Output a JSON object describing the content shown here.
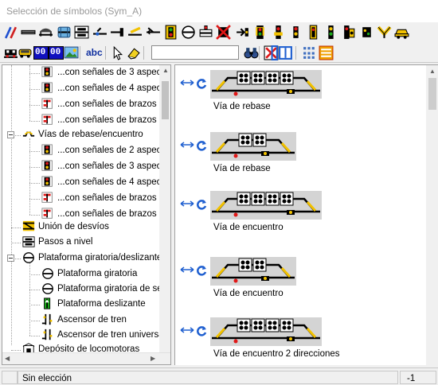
{
  "window": {
    "title": "Selección de símbolos (Sym_A)"
  },
  "toolbar1": {
    "icons": [
      "pencils-icon",
      "straight-track-icon",
      "tunnel-icon",
      "bridge-icon",
      "level-crossing-icon",
      "turnout-left-icon",
      "track-end-icon",
      "signal-yellow-icon",
      "turnout-right-icon",
      "signal-block-icon",
      "turntable-icon",
      "cross-signal-icon",
      "no-signal-icon",
      "arrow-signal-icon",
      "main-signal-icon",
      "shunt-signal-icon",
      "dwarf-signal-icon",
      "light-signal-icon",
      "distant-signal-icon",
      "combined-signal-icon",
      "repeater-signal-icon",
      "bumper-icon",
      "car-icon"
    ]
  },
  "toolbar2": {
    "icons": [
      "locomotive-icon",
      "car-yellow-icon",
      "digit-display-icon",
      "digit-display2-icon",
      "picture-icon",
      "text-abc-icon",
      "pointer-icon",
      "eraser-icon",
      "binoculars-icon",
      "no-symbol-icon",
      "frame-icon",
      "grid-view-icon",
      "list-view-icon"
    ],
    "abc_label": "abc",
    "display1": "00",
    "display2": "00",
    "search_value": ""
  },
  "tree": {
    "items": [
      {
        "label": "...con señales de 3 aspec",
        "icon": "signal-3-icon"
      },
      {
        "label": "...con señales de 4 aspec",
        "icon": "signal-4-icon"
      },
      {
        "label": "...con señales de brazos d",
        "icon": "semaphore-icon"
      },
      {
        "label": "...con señales de brazos d",
        "icon": "semaphore2-icon"
      },
      {
        "label": "Vías de rebase/encuentro",
        "icon": "passing-track-icon"
      },
      {
        "label": "...con señales de 2 aspec",
        "icon": "signal-2-icon"
      },
      {
        "label": "...con señales de 3 aspec",
        "icon": "signal-3-icon"
      },
      {
        "label": "...con señales de 4 aspec",
        "icon": "signal-4-icon"
      },
      {
        "label": "...con señales de brazos d",
        "icon": "semaphore-icon"
      },
      {
        "label": "...con señales de brazos d",
        "icon": "semaphore2-icon"
      },
      {
        "label": "Unión de desvíos",
        "icon": "crossover-icon"
      },
      {
        "label": "Pasos a nivel",
        "icon": "level-crossing-icon"
      },
      {
        "label": "Plataforma giratoria/deslizante/",
        "icon": "turntable-icon"
      },
      {
        "label": "Plataforma giratoria",
        "icon": "turntable-icon"
      },
      {
        "label": "Plataforma giratoria de se",
        "icon": "turntable-icon"
      },
      {
        "label": "Plataforma deslizante",
        "icon": "transfer-table-icon"
      },
      {
        "label": "Ascensor de tren",
        "icon": "train-lift-icon"
      },
      {
        "label": "Ascensor de tren universa",
        "icon": "train-lift-icon"
      },
      {
        "label": "Depósito de locomotoras",
        "icon": "depot-icon"
      }
    ]
  },
  "symbols": [
    {
      "caption": "Vía de rebase",
      "variant": "large"
    },
    {
      "caption": "Vía de rebase",
      "variant": "small"
    },
    {
      "caption": "Vía de encuentro",
      "variant": "large"
    },
    {
      "caption": "Vía de encuentro",
      "variant": "small"
    },
    {
      "caption": "Vía de encuentro 2 direcciones",
      "variant": "large"
    }
  ],
  "status": {
    "text": "Sin elección",
    "value": "-1"
  },
  "colors": {
    "track_bg": "#d4d4d4",
    "track_line": "#000000",
    "yellow": "#f2c200",
    "red": "#e01818",
    "green": "#18a818",
    "blue": "#2060d0"
  }
}
